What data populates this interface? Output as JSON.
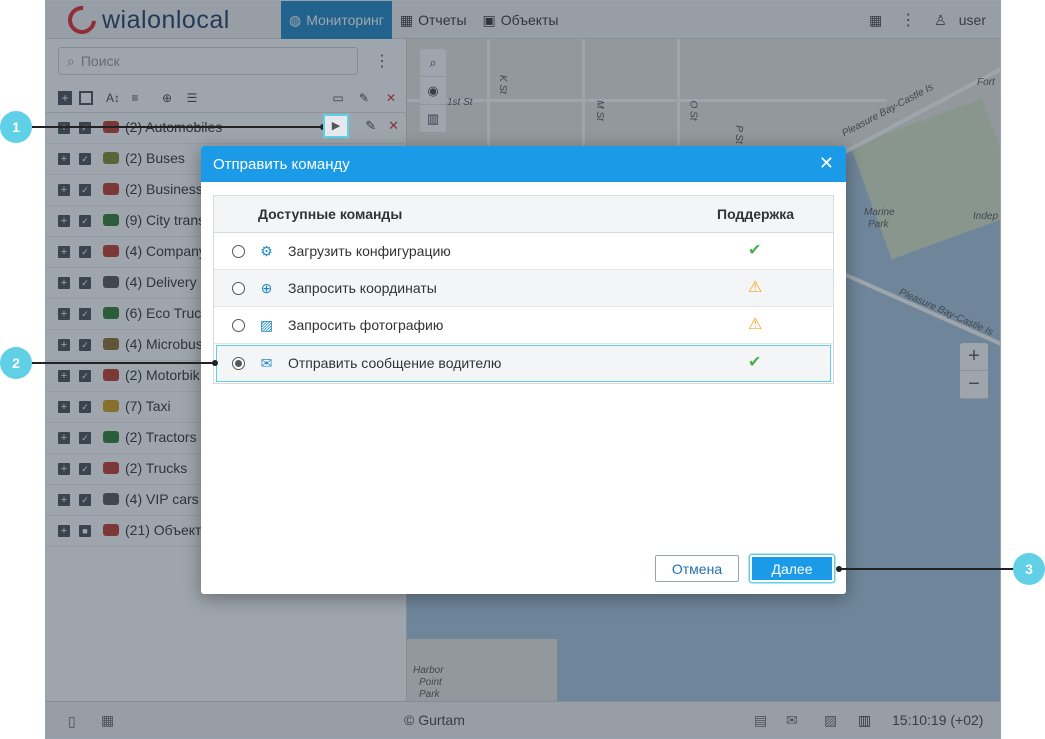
{
  "logo": {
    "text": "wialon",
    "text2": "local"
  },
  "nav": [
    {
      "label": "Мониторинг",
      "icon": "globe-icon"
    },
    {
      "label": "Отчеты",
      "icon": "report-icon"
    },
    {
      "label": "Объекты",
      "icon": "bus-icon"
    }
  ],
  "user": {
    "name": "user"
  },
  "search": {
    "placeholder": "Поиск"
  },
  "units": [
    {
      "label": "(2) Automobiles",
      "color": "#c0392b"
    },
    {
      "label": "(2) Buses",
      "color": "#7f8c2d"
    },
    {
      "label": "(2) Business",
      "color": "#c0392b"
    },
    {
      "label": "(9) City trans",
      "color": "#2e7d32"
    },
    {
      "label": "(4) Company",
      "color": "#c0392b"
    },
    {
      "label": "(4) Delivery s",
      "color": "#555"
    },
    {
      "label": "(6) Eco Truc",
      "color": "#2e7d32"
    },
    {
      "label": "(4) Microbus",
      "color": "#8d6e2a"
    },
    {
      "label": "(2) Motorbik",
      "color": "#c0392b"
    },
    {
      "label": "(7) Taxi",
      "color": "#d4a017"
    },
    {
      "label": "(2) Tractors",
      "color": "#2e7d32"
    },
    {
      "label": "(2) Trucks",
      "color": "#c0392b"
    },
    {
      "label": "(4) VIP cars",
      "color": "#555"
    },
    {
      "label": "(21) Объект",
      "color": "#c0392b"
    }
  ],
  "map": {
    "labels": [
      "1st St",
      "K St",
      "M St",
      "O St",
      "P St",
      "Fort",
      "Pleasure Bay-Castle Is",
      "Marine",
      "Park",
      "Indep",
      "Harbor",
      "Point",
      "Park",
      "Pleasure Bay-Castle Is"
    ]
  },
  "status": {
    "copyright": "© Gurtam",
    "time": "15:10:19 (+02)"
  },
  "dialog": {
    "title": "Отправить команду",
    "col_commands": "Доступные команды",
    "col_support": "Поддержка",
    "commands": [
      {
        "label": "Загрузить конфигурацию",
        "support": "ok",
        "selected": false
      },
      {
        "label": "Запросить координаты",
        "support": "warn",
        "selected": false
      },
      {
        "label": "Запросить фотографию",
        "support": "warn",
        "selected": false
      },
      {
        "label": "Отправить сообщение водителю",
        "support": "ok",
        "selected": true
      }
    ],
    "cancel": "Отмена",
    "next": "Далее"
  },
  "callouts": [
    "1",
    "2",
    "3"
  ]
}
